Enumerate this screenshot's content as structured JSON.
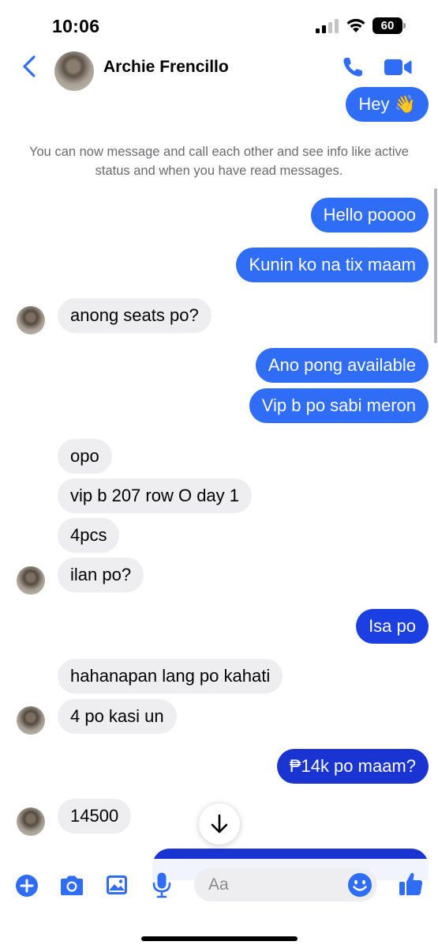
{
  "status_bar": {
    "time": "10:06",
    "battery": "60"
  },
  "header": {
    "name": "Archie Frencillo"
  },
  "notice": "You can now message and call each other and see info like active status and when you have read messages.",
  "messages": {
    "m0": "Hey 👋",
    "m1": "Hello poooo",
    "m2": "Kunin ko na tix maam",
    "m3": "anong seats po?",
    "m4": "Ano pong available",
    "m5": "Vip b po sabi meron",
    "m6": "opo",
    "m7": "vip b 207 row O day 1",
    "m8": "4pcs",
    "m9": "ilan po?",
    "m10": "Isa po",
    "m11": "hahanapan lang po kahati",
    "m12": "4 po kasi un",
    "m13": "₱14k po maam?",
    "m14": "14500"
  },
  "composer": {
    "placeholder": "Aa"
  },
  "colors": {
    "accent": "#2f6df6",
    "outgoing_bubble": "#2f6df6",
    "outgoing_bubble_deep": "#1a34d1",
    "incoming_bubble": "#eeeef0",
    "notice_text": "#6b6b70"
  },
  "icons": {
    "back": "chevron-left-icon",
    "call": "phone-icon",
    "video": "video-camera-icon",
    "plus": "plus-circle-icon",
    "camera": "camera-icon",
    "gallery": "image-icon",
    "mic": "microphone-icon",
    "emoji": "smiley-icon",
    "like": "thumbs-up-icon",
    "scroll": "arrow-down-icon"
  }
}
